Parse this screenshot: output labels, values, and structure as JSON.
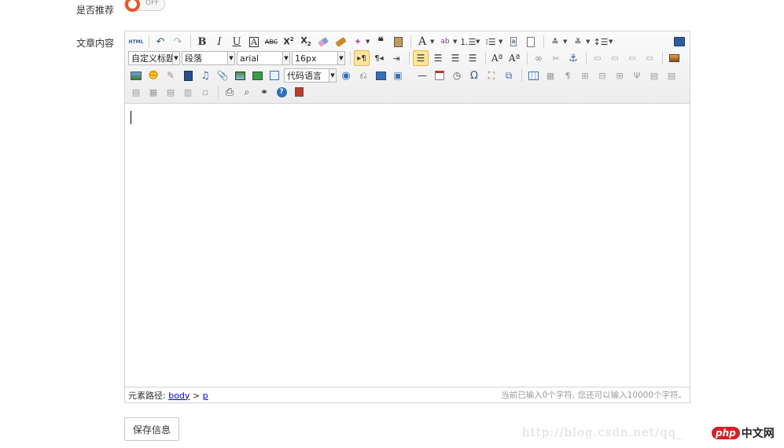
{
  "form": {
    "recommend_label": "是否推荐",
    "recommend_toggle_state": "OFF",
    "content_label": "文章内容",
    "save_label": "保存信息"
  },
  "editor": {
    "toolbar": {
      "html_label": "HTML",
      "custom_title": "自定义标题",
      "paragraph": "段落",
      "font_family": "arial",
      "font_size": "16px",
      "code_language": "代码语言"
    },
    "status": {
      "path_label": "元素路径:",
      "path_body": "body",
      "path_sep": ">",
      "path_p": "p",
      "word_count": "当前已输入0个字符, 您还可以输入10000个字符。"
    }
  },
  "watermark": {
    "url": "http://blog.csdn.net/qq_",
    "php_badge": "php",
    "php_text": "中文网"
  },
  "colors": {
    "accent_toggle": "#e8562a",
    "link": "#0000cc",
    "php_red": "#d2202a"
  }
}
